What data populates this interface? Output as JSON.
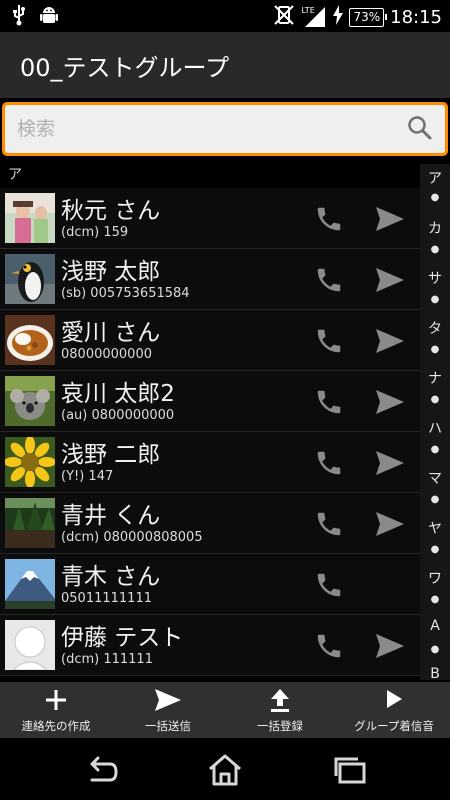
{
  "status": {
    "time": "18:15",
    "battery": "73%",
    "network": "LTE",
    "icons": [
      "usb-icon",
      "android-icon",
      "vibrate-off-icon",
      "signal-icon",
      "charging-icon"
    ]
  },
  "header": {
    "title": "00_テストグループ"
  },
  "search": {
    "placeholder": "検索"
  },
  "section": {
    "label": "ア"
  },
  "contacts": [
    {
      "name": "秋元 さん",
      "sub": "(dcm) 159",
      "photo": "photo-portrait-pink",
      "has_send": true
    },
    {
      "name": "浅野 太郎",
      "sub": "(sb) 005753651584",
      "photo": "photo-penguin",
      "has_send": true
    },
    {
      "name": "愛川 さん",
      "sub": "08000000000",
      "photo": "photo-curry",
      "has_send": true
    },
    {
      "name": "哀川 太郎2",
      "sub": "(au) 0800000000",
      "photo": "photo-koala",
      "has_send": true
    },
    {
      "name": "浅野 二郎",
      "sub": "(Y!) 147",
      "photo": "photo-sunflower",
      "has_send": true
    },
    {
      "name": "青井 くん",
      "sub": "(dcm) 080000808005",
      "photo": "photo-forest",
      "has_send": true
    },
    {
      "name": "青木 さん",
      "sub": "05011111111",
      "photo": "photo-mount-fuji",
      "has_send": false
    },
    {
      "name": "伊藤 テスト",
      "sub": "(dcm) 111111",
      "photo": "photo-default-avatar",
      "has_send": true
    }
  ],
  "index": [
    "ア",
    "カ",
    "サ",
    "タ",
    "ナ",
    "ハ",
    "マ",
    "ヤ",
    "ワ",
    "A",
    "B"
  ],
  "actions": [
    {
      "label": "連絡先の作成",
      "icon": "plus-icon"
    },
    {
      "label": "一括送信",
      "icon": "send-icon"
    },
    {
      "label": "一括登録",
      "icon": "upload-icon"
    },
    {
      "label": "グループ着信音",
      "icon": "play-icon"
    }
  ],
  "nav": [
    "back-icon",
    "home-icon",
    "recents-icon"
  ],
  "colors": {
    "accent": "#ff8c00",
    "title_bar": "#292929",
    "action_bar": "#303030",
    "icon_gray": "#8a8a8a"
  }
}
